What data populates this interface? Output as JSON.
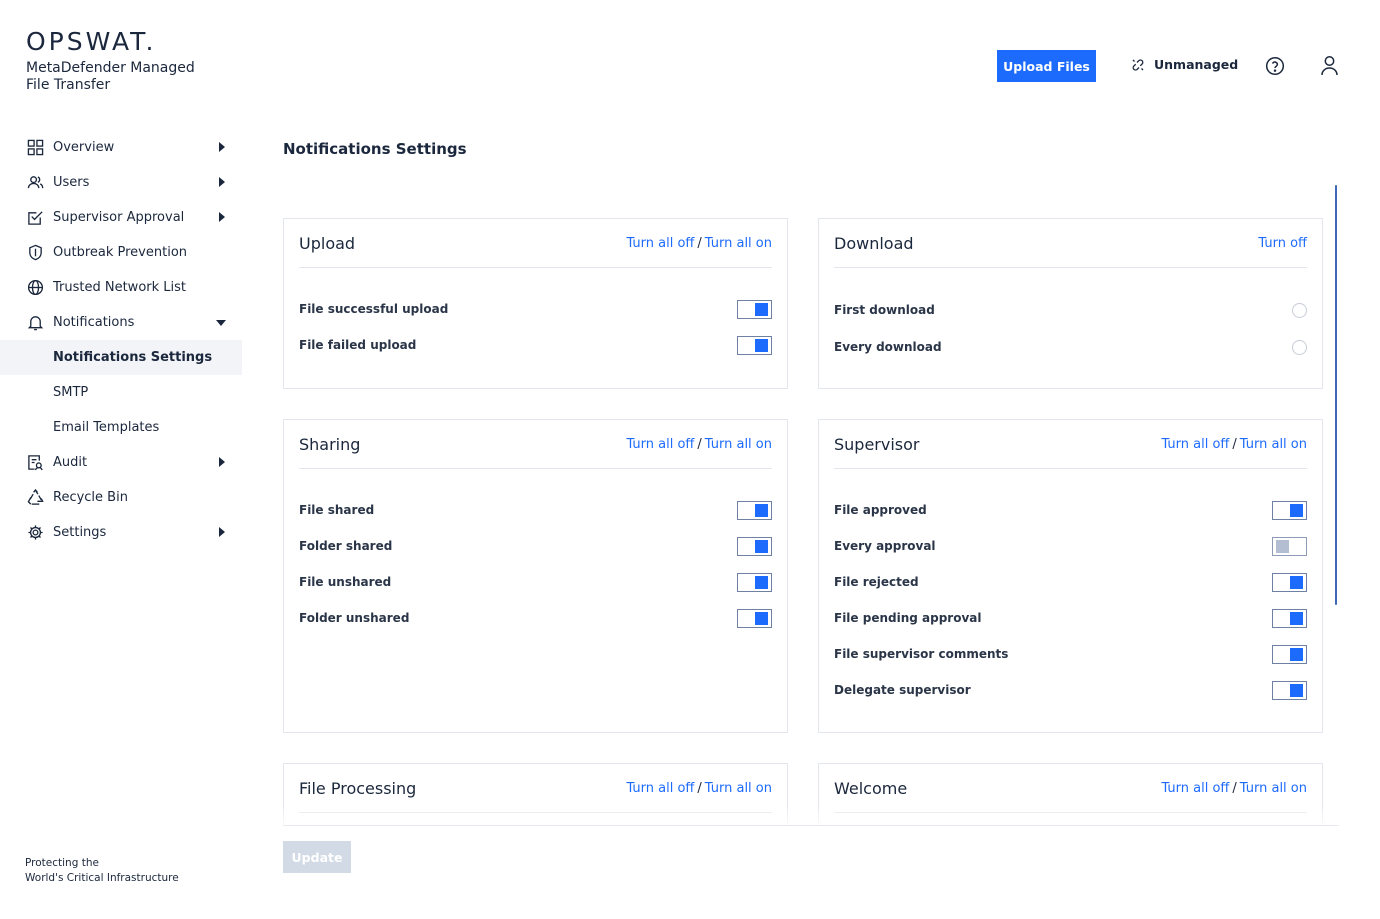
{
  "brand": {
    "logo": "OPSWAT.",
    "product": "MetaDefender Managed File Transfer",
    "tagline_line1": "Protecting the",
    "tagline_line2": "World's Critical Infrastructure"
  },
  "header": {
    "upload_label": "Upload Files",
    "unmanaged_label": "Unmanaged",
    "icons": {
      "help": "help-circle-icon",
      "user": "user-icon",
      "unmanaged": "link-icon"
    }
  },
  "sidebar": {
    "items": [
      {
        "label": "Overview",
        "icon": "grid-icon",
        "caret": "right"
      },
      {
        "label": "Users",
        "icon": "users-icon",
        "caret": "right"
      },
      {
        "label": "Supervisor Approval",
        "icon": "checklist-icon",
        "caret": "right"
      },
      {
        "label": "Outbreak Prevention",
        "icon": "shield-icon",
        "caret": "none"
      },
      {
        "label": "Trusted Network List",
        "icon": "globe-icon",
        "caret": "none"
      },
      {
        "label": "Notifications",
        "icon": "bell-icon",
        "caret": "down"
      },
      {
        "label": "Notifications Settings",
        "sub": true,
        "active": true
      },
      {
        "label": "SMTP",
        "sub": true
      },
      {
        "label": "Email Templates",
        "sub": true
      },
      {
        "label": "Audit",
        "icon": "audit-icon",
        "caret": "right"
      },
      {
        "label": "Recycle Bin",
        "icon": "recycle-icon",
        "caret": "none"
      },
      {
        "label": "Settings",
        "icon": "gear-icon",
        "caret": "right"
      }
    ]
  },
  "page": {
    "title": "Notifications Settings",
    "update_label": "Update"
  },
  "common": {
    "turn_all_off": "Turn all off",
    "turn_all_on": "Turn all on",
    "slash": "/",
    "turn_off": "Turn off"
  },
  "cards": {
    "upload": {
      "title": "Upload",
      "rows": [
        {
          "label": "File successful upload",
          "on": true
        },
        {
          "label": "File failed upload",
          "on": true
        }
      ]
    },
    "download": {
      "title": "Download",
      "rows": [
        {
          "label": "First download",
          "selected": false
        },
        {
          "label": "Every download",
          "selected": false
        }
      ]
    },
    "sharing": {
      "title": "Sharing",
      "rows": [
        {
          "label": "File shared",
          "on": true
        },
        {
          "label": "Folder shared",
          "on": true
        },
        {
          "label": "File unshared",
          "on": true
        },
        {
          "label": "Folder unshared",
          "on": true
        }
      ]
    },
    "supervisor": {
      "title": "Supervisor",
      "rows": [
        {
          "label": "File approved",
          "on": true
        },
        {
          "label": "Every approval",
          "on": false
        },
        {
          "label": "File rejected",
          "on": true
        },
        {
          "label": "File pending approval",
          "on": true
        },
        {
          "label": "File supervisor comments",
          "on": true
        },
        {
          "label": "Delegate supervisor",
          "on": true
        }
      ]
    },
    "file_processing": {
      "title": "File Processing"
    },
    "welcome": {
      "title": "Welcome"
    }
  },
  "colors": {
    "accent": "#1d6bfc",
    "text": "#1b273c",
    "border": "#e3e6ec",
    "disabled": "#d2dae6"
  }
}
